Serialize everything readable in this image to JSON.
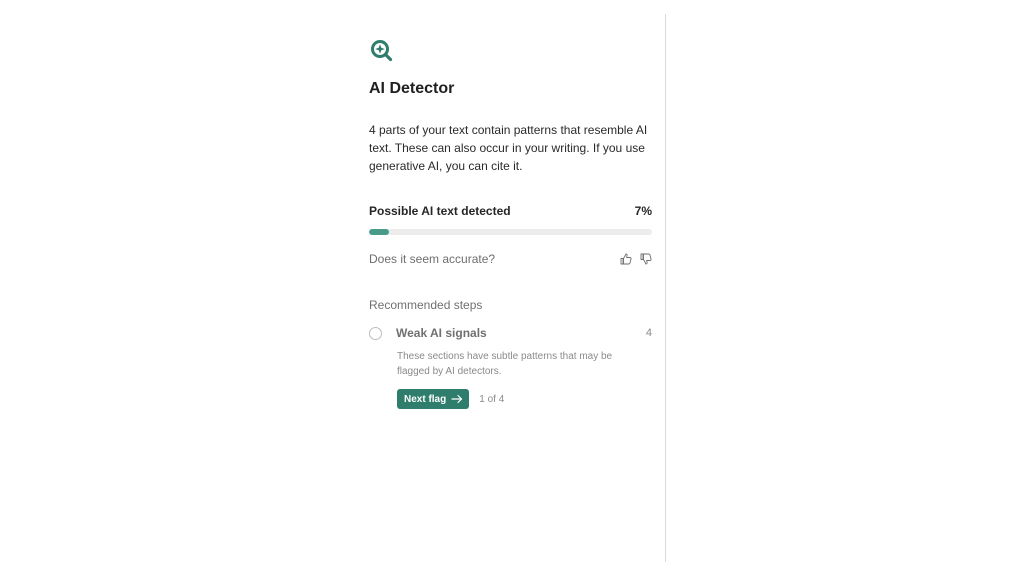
{
  "detector": {
    "title": "AI Detector",
    "description": "4 parts of your text contain patterns that resemble AI text. These can also occur in your writing. If you use generative AI, you can cite it.",
    "metric_label": "Possible AI text detected",
    "metric_value": "7%",
    "metric_fraction": 0.07,
    "feedback_question": "Does it seem accurate?",
    "icons": [
      "ai-detector-logo-icon",
      "thumbs-up-icon",
      "thumbs-down-icon",
      "arrow-right-icon"
    ],
    "accent_color": "#2f7d6c",
    "bar_color": "#4a9a88"
  },
  "recommended": {
    "title": "Recommended steps",
    "step": {
      "label": "Weak AI signals",
      "count": "4",
      "description": "These sections have subtle patterns that may be flagged by AI detectors.",
      "next_label": "Next flag",
      "pager": "1 of 4"
    }
  }
}
